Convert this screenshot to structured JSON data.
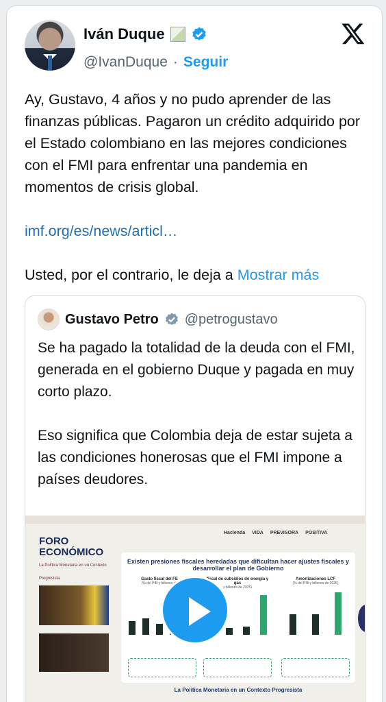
{
  "author": {
    "name": "Iván Duque",
    "handle": "@IvanDuque",
    "separator": "·",
    "follow_label": "Seguir"
  },
  "tweet": {
    "text": "Ay, Gustavo, 4 años y no pudo aprender de las finanzas públicas. Pagaron un crédito adquirido por el Estado colombiano en las mejores condiciones con el FMI para enfrentar una pandemia en momentos de crisis global.",
    "link": "imf.org/es/news/articl…",
    "tail": "Usted, por el contrario, le deja a",
    "show_more": "Mostrar más"
  },
  "quoted": {
    "name": "Gustavo Petro",
    "handle": "@petrogustavo",
    "paragraph1": "Se ha pagado la totalidad de la deuda con el FMI, generada en el gobierno Duque y pagada en muy corto plazo.",
    "paragraph2": "Eso significa que Colombia deja de estar sujeta a las condiciones honerosas que el FMI impone a países deudores."
  },
  "video": {
    "foro_title": "FORO ECONÓMICO",
    "foro_sub": "La Política Monetaria en un Contexto Progresista",
    "sponsors": [
      "Hacienda",
      "VIDA",
      "PREVISORA",
      "POSITIVA"
    ],
    "slide_title": "Existen presiones fiscales heredadas que dificultan hacer ajustes fiscales y desarrollar el plan de Gobierno",
    "chart1_title": "Gasto fiscal del FE",
    "chart1_sub": "(% del PIB y billones de",
    "chart2_title": "fiscal de subsidios de energía y gas",
    "chart2_sub": "y billones de 2025)",
    "chart3_title": "Amortizaciones LCF",
    "chart3_sub": "(% del PIB y billones de 2025)",
    "footer": "La Política Monetaria en un Contexto Progresista"
  },
  "colors": {
    "link": "#1d6fb8",
    "accent": "#1d9bf0",
    "verified": "#1d9bf0"
  }
}
